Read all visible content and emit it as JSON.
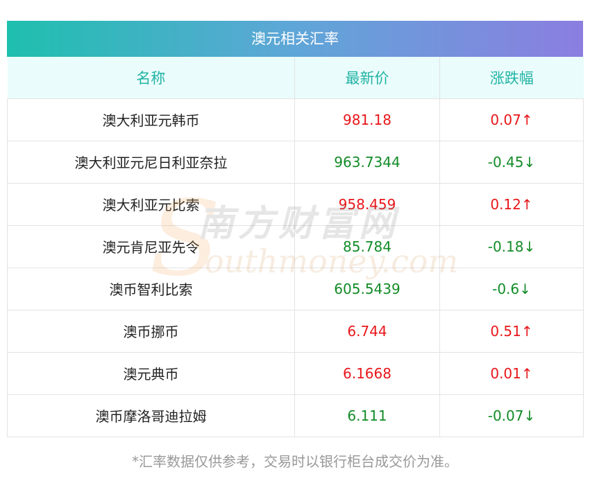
{
  "table": {
    "title": "澳元相关汇率",
    "headers": [
      "名称",
      "最新价",
      "涨跌幅"
    ],
    "rows": [
      {
        "name": "澳大利亚元韩币",
        "price": "981.18",
        "change": "0.07↑",
        "dir": "up"
      },
      {
        "name": "澳大利亚元尼日利亚奈拉",
        "price": "963.7344",
        "change": "-0.45↓",
        "dir": "down"
      },
      {
        "name": "澳大利亚元比索",
        "price": "958.459",
        "change": "0.12↑",
        "dir": "up"
      },
      {
        "name": "澳元肯尼亚先令",
        "price": "85.784",
        "change": "-0.18↓",
        "dir": "down"
      },
      {
        "name": "澳币智利比索",
        "price": "605.5439",
        "change": "-0.6↓",
        "dir": "down"
      },
      {
        "name": "澳币挪币",
        "price": "6.744",
        "change": "0.51↑",
        "dir": "up"
      },
      {
        "name": "澳元典币",
        "price": "6.1668",
        "change": "0.01↑",
        "dir": "up"
      },
      {
        "name": "澳币摩洛哥迪拉姆",
        "price": "6.111",
        "change": "-0.07↓",
        "dir": "down"
      }
    ]
  },
  "watermark": {
    "cn": "南方财富网",
    "en": "outhmoney.com",
    "initial": "S"
  },
  "footnote": "*汇率数据仅供参考，交易时以银行柜台成交价为准。",
  "colors": {
    "up": "#e8161a",
    "down": "#118b26",
    "header_text": "#22b3a5",
    "header_bg": "#eafcfb",
    "title_gradient_start": "#1ebfae",
    "title_gradient_end": "#8b7ee0"
  }
}
